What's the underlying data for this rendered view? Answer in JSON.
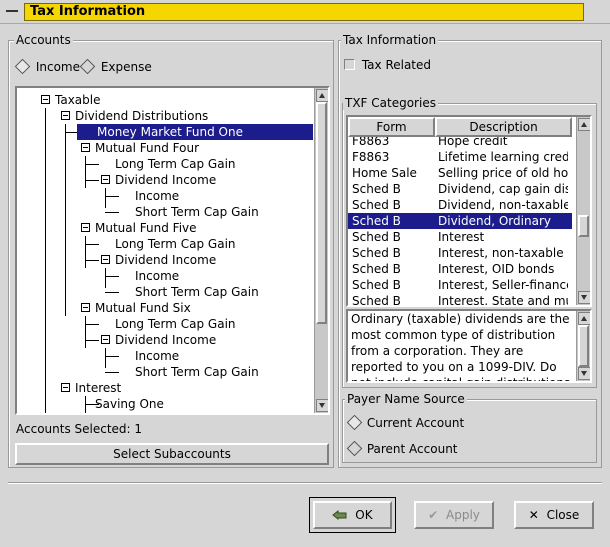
{
  "window": {
    "title": "Tax Information"
  },
  "accounts": {
    "frame_label": "Accounts",
    "radio_income": "Income",
    "radio_expense": "Expense",
    "tree": [
      {
        "label": "Taxable"
      },
      {
        "label": "Dividend Distributions"
      },
      {
        "label": "Money Market Fund One"
      },
      {
        "label": "Mutual Fund Four"
      },
      {
        "label": "Long Term Cap Gain"
      },
      {
        "label": "Dividend Income"
      },
      {
        "label": "Income"
      },
      {
        "label": "Short Term Cap Gain"
      },
      {
        "label": "Mutual Fund Five"
      },
      {
        "label": "Long Term Cap Gain"
      },
      {
        "label": "Dividend Income"
      },
      {
        "label": "Income"
      },
      {
        "label": "Short Term Cap Gain"
      },
      {
        "label": "Mutual Fund Six"
      },
      {
        "label": "Long Term Cap Gain"
      },
      {
        "label": "Dividend Income"
      },
      {
        "label": "Income"
      },
      {
        "label": "Short Term Cap Gain"
      },
      {
        "label": "Interest"
      },
      {
        "label": "Saving One"
      }
    ],
    "selected_label": "Accounts Selected:",
    "selected_count": "1",
    "select_sub_button": "Select Subaccounts"
  },
  "tax_info": {
    "frame_label": "Tax Information",
    "tax_related_label": "Tax Related",
    "txf_frame_label": "TXF Categories",
    "col_form": "Form",
    "col_desc": "Description",
    "rows": [
      {
        "form": "F8863",
        "desc": "Hope credit"
      },
      {
        "form": "F8863",
        "desc": "Lifetime learning credit"
      },
      {
        "form": "Home Sale",
        "desc": "Selling price of old hor"
      },
      {
        "form": "Sched B",
        "desc": "Dividend, cap gain dis"
      },
      {
        "form": "Sched B",
        "desc": "Dividend, non-taxable"
      },
      {
        "form": "Sched B",
        "desc": "Dividend, Ordinary"
      },
      {
        "form": "Sched B",
        "desc": "Interest"
      },
      {
        "form": "Sched B",
        "desc": "Interest, non-taxable"
      },
      {
        "form": "Sched B",
        "desc": "Interest, OID bonds"
      },
      {
        "form": "Sched B",
        "desc": "Interest, Seller-finance"
      },
      {
        "form": "Sched B",
        "desc": "Interest, State and mun"
      }
    ],
    "description_text": "Ordinary (taxable) dividends are the most common type of distribution from a corporation.  They are reported to you on a 1099-DIV.  Do not include capital gain distributions or non-taxable",
    "payer_frame_label": "Payer Name Source",
    "payer_current": "Current Account",
    "payer_parent": "Parent Account"
  },
  "buttons": {
    "ok": "OK",
    "apply": "Apply",
    "close": "Close"
  },
  "colors": {
    "title_bg": "#f5d600",
    "selection": "#1c1c8c"
  }
}
